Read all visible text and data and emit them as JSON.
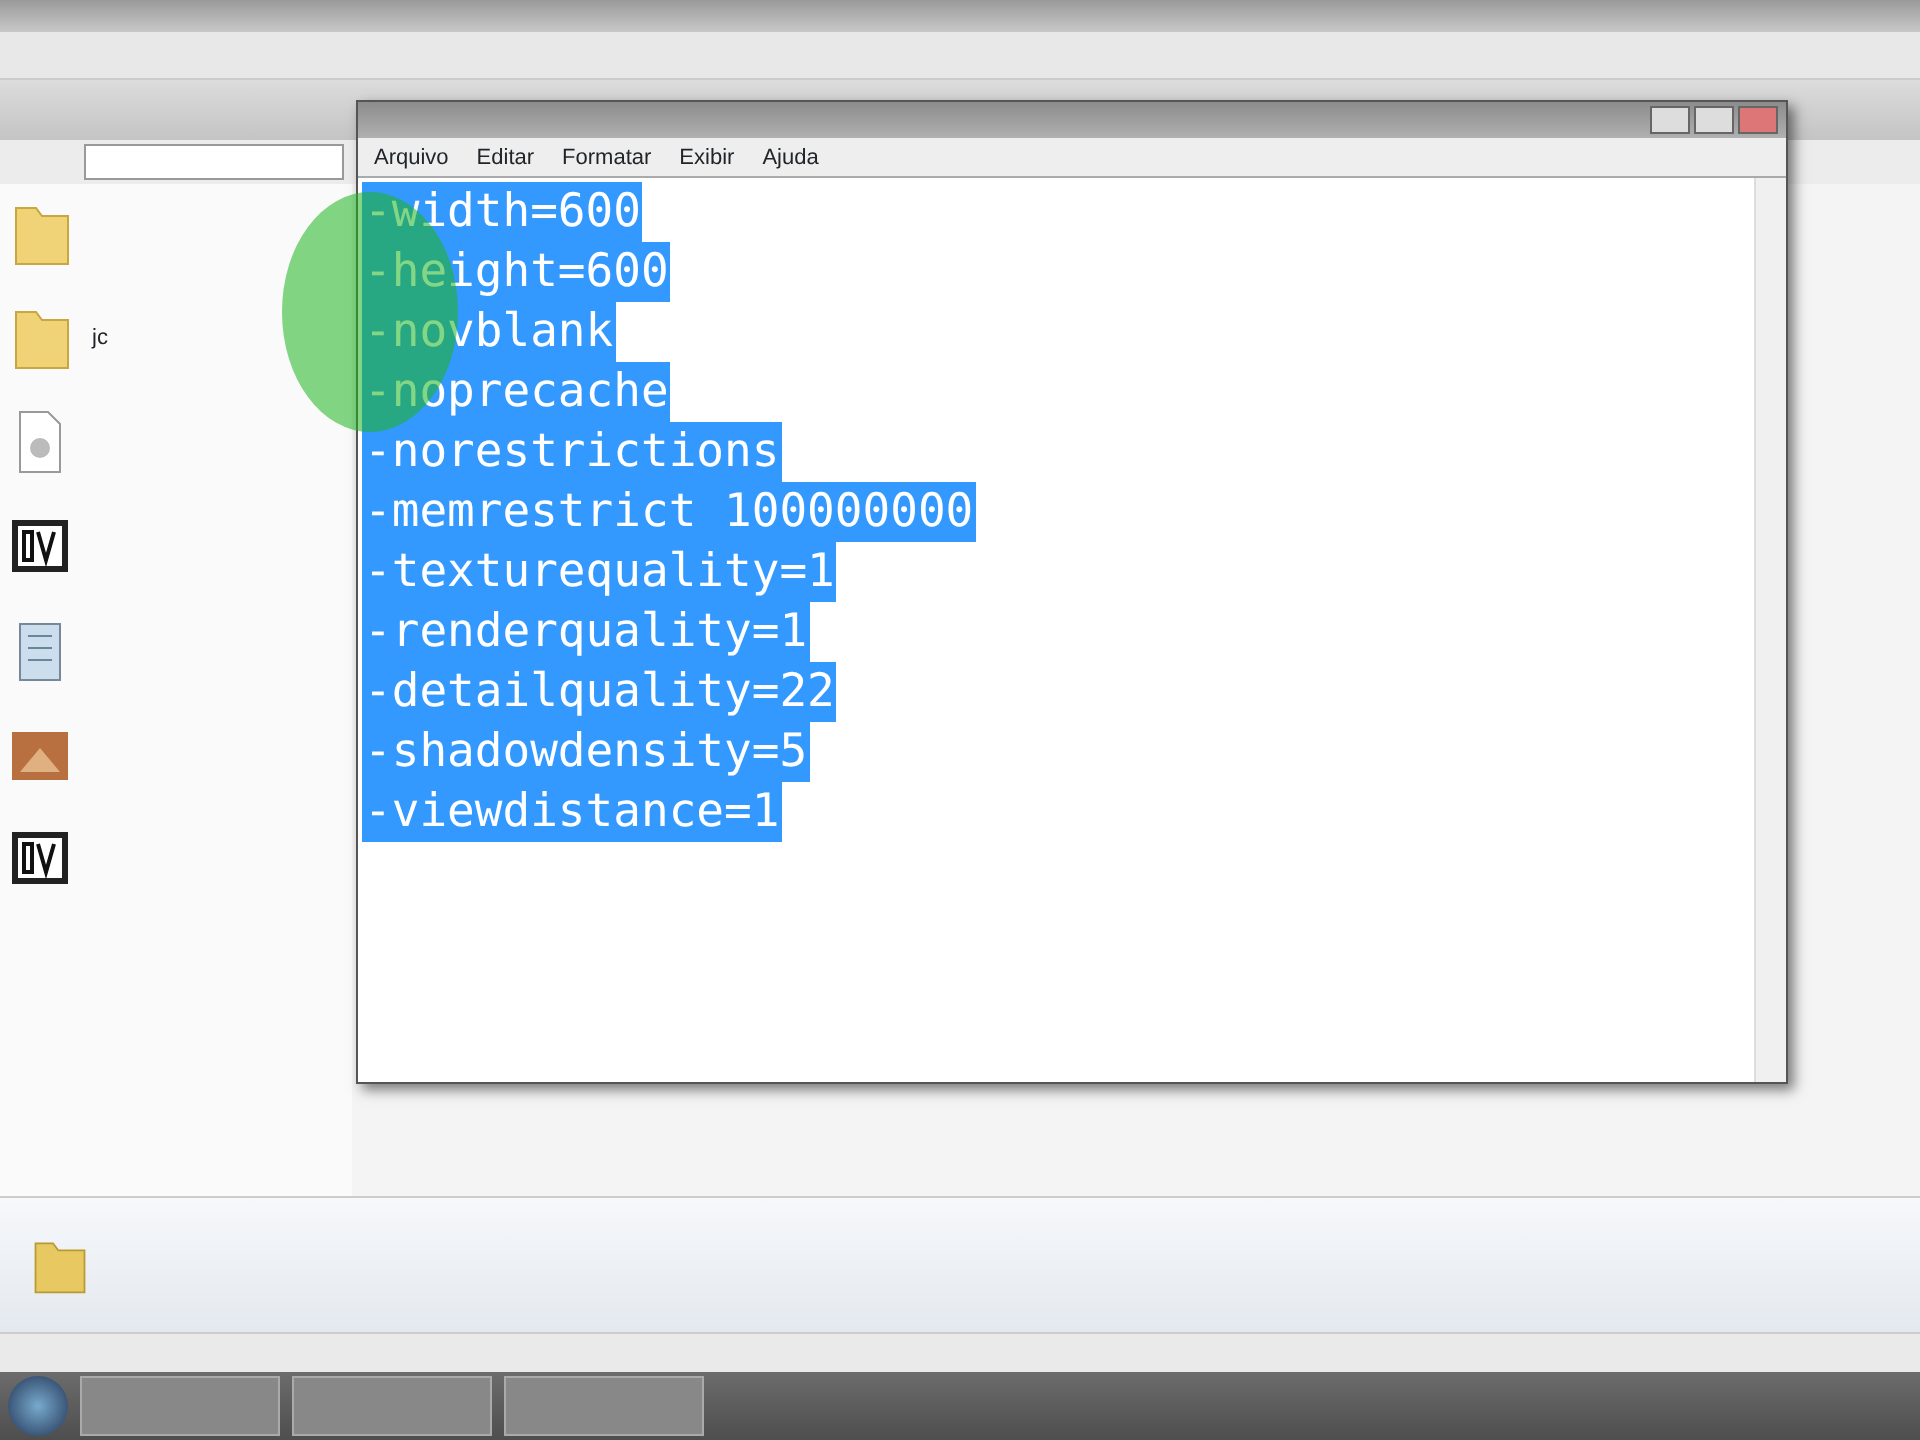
{
  "explorer": {
    "files": [
      {
        "kind": "folder"
      },
      {
        "kind": "folder",
        "name": "jc"
      },
      {
        "kind": "document"
      },
      {
        "kind": "app"
      },
      {
        "kind": "notepad"
      },
      {
        "kind": "image"
      },
      {
        "kind": "app"
      }
    ]
  },
  "notepad": {
    "menu": [
      "Arquivo",
      "Editar",
      "Formatar",
      "Exibir",
      "Ajuda"
    ],
    "selected": true,
    "lines": [
      "-width=600",
      "-height=600",
      "-novblank",
      "-noprecache",
      "-norestrictions",
      "-memrestrict 100000000",
      "-texturequality=1",
      "-renderquality=1",
      "-detailquality=22",
      "-shadowdensity=5",
      "-viewdistance=1"
    ]
  }
}
